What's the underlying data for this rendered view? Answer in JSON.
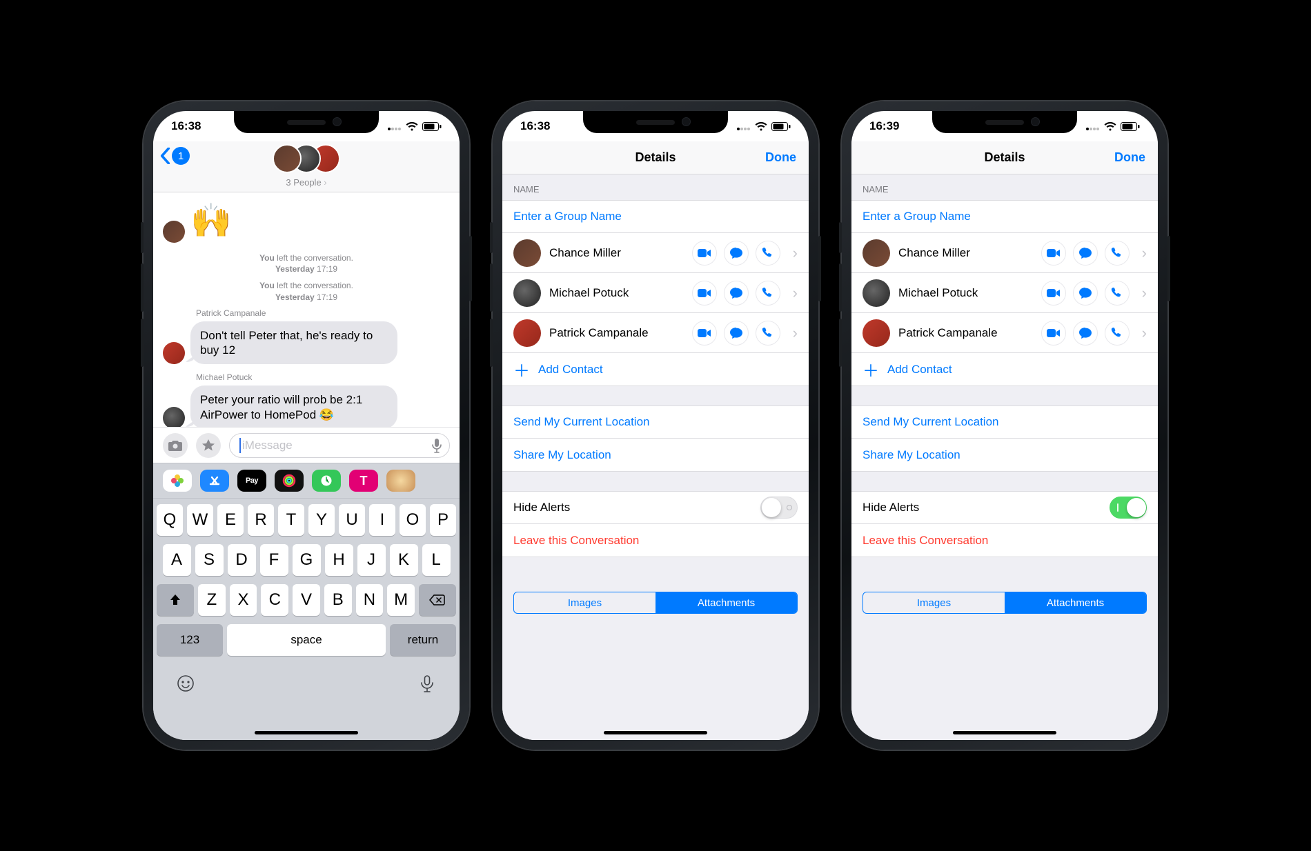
{
  "phones": {
    "chat": {
      "time": "16:38",
      "back_badge": "1",
      "people_label": "3 People",
      "big_emoji": "🙌",
      "system1": {
        "prefix": "You",
        "text": " left the conversation.",
        "day": "Yesterday",
        "time": "17:19"
      },
      "system2": {
        "prefix": "You",
        "text": " left the conversation.",
        "day": "Yesterday",
        "time": "17:19"
      },
      "msg1": {
        "sender": "Patrick Campanale",
        "text": "Don't tell Peter that, he's ready to buy 12"
      },
      "msg2": {
        "sender": "Michael Potuck",
        "text": "Peter your ratio will prob be 2:1 AirPower to HomePod 😂"
      },
      "input_placeholder": "iMessage",
      "keyboard": {
        "row1": [
          "Q",
          "W",
          "E",
          "R",
          "T",
          "Y",
          "U",
          "I",
          "O",
          "P"
        ],
        "row2": [
          "A",
          "S",
          "D",
          "F",
          "G",
          "H",
          "J",
          "K",
          "L"
        ],
        "row3": [
          "Z",
          "X",
          "C",
          "V",
          "B",
          "N",
          "M"
        ],
        "num": "123",
        "space": "space",
        "ret": "return"
      }
    },
    "details": {
      "time_a": "16:38",
      "time_b": "16:39",
      "title": "Details",
      "done": "Done",
      "name_section": "NAME",
      "name_placeholder": "Enter a Group Name",
      "contacts": [
        {
          "name": "Chance Miller"
        },
        {
          "name": "Michael Potuck"
        },
        {
          "name": "Patrick Campanale"
        }
      ],
      "add_contact": "Add Contact",
      "send_location": "Send My Current Location",
      "share_location": "Share My Location",
      "hide_alerts": "Hide Alerts",
      "leave": "Leave this Conversation",
      "seg_images": "Images",
      "seg_attachments": "Attachments"
    }
  }
}
